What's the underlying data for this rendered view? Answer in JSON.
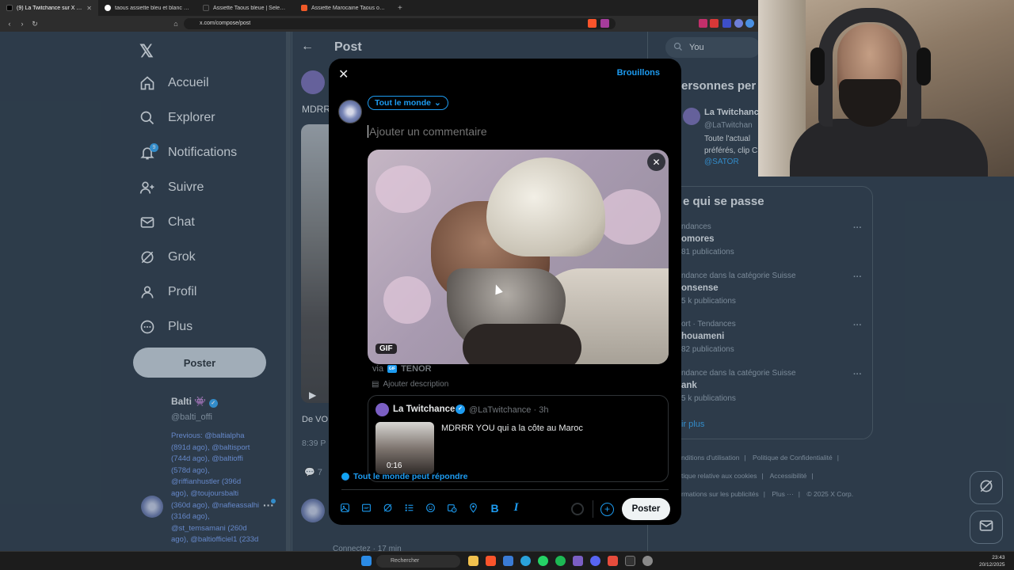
{
  "browser": {
    "tabs": [
      {
        "label": "(9) La Twitchance sur X : \"MDRR",
        "active": true,
        "color": "#000000"
      },
      {
        "label": "taous assiette bleu et blanc - Recher",
        "active": false,
        "color": "#4285f4"
      },
      {
        "label": "Assiette Taous bleue | Selency",
        "active": false,
        "color": "#222222"
      },
      {
        "label": "Assiette Marocaine Taous originale d",
        "active": false,
        "color": "#f05a28"
      }
    ],
    "url": "x.com/compose/post"
  },
  "nav": {
    "items": [
      {
        "label": "Accueil",
        "icon": "home-icon"
      },
      {
        "label": "Explorer",
        "icon": "search-icon"
      },
      {
        "label": "Notifications",
        "icon": "bell-icon",
        "badge": "9"
      },
      {
        "label": "Suivre",
        "icon": "follow-icon"
      },
      {
        "label": "Chat",
        "icon": "mail-icon"
      },
      {
        "label": "Grok",
        "icon": "grok-icon"
      },
      {
        "label": "Profil",
        "icon": "profile-icon"
      },
      {
        "label": "Plus",
        "icon": "more-icon"
      }
    ],
    "post_button": "Poster"
  },
  "profile": {
    "name": "Balti",
    "emoji": "👾",
    "handle": "@balti_offi",
    "bio": "Previous: @baltialpha (891d ago), @baltisport (744d ago), @baltioffi (578d ago), @riffianhustler (396d ago), @toujoursbalti (360d ago), @nafieassalhi (316d ago), @st_temsamani (260d ago), @baltiofficiel1 (233d",
    "more": "···"
  },
  "middle": {
    "title": "Post",
    "text": "MDRR",
    "de": "De VO",
    "time": "8:39 P",
    "reply_count": "7",
    "bottom_text": "Connectez · 17 min"
  },
  "right": {
    "search": "You",
    "suggest_heading": "ersonnes per",
    "suggest_name": "La Twitchanc",
    "suggest_handle": "@LaTwitchan",
    "suggest_bio": "Toute l'actual préférés, clip CM :",
    "suggest_link": "@SATOR",
    "trends_heading": "e qui se passe",
    "trends": [
      {
        "category": "ndances",
        "name": "omores",
        "count": "81 publications"
      },
      {
        "category": "ndance dans la catégorie Suisse",
        "name": "onsense",
        "count": "5 k publications"
      },
      {
        "category": "ort · Tendances",
        "name": "houameni",
        "count": "82 publications"
      },
      {
        "category": "ndance dans la catégorie Suisse",
        "name": "ank",
        "count": "5 k publications"
      }
    ],
    "see_more": "ir plus",
    "footer": [
      "nditions d'utilisation",
      "Politique de Confidentialité",
      "tique relative aux cookies",
      "Accessibilité",
      "rmations sur les publicités",
      "Plus ···",
      "© 2025 X Corp."
    ]
  },
  "modal": {
    "close": "✕",
    "drafts": "Brouillons",
    "audience": "Tout le monde",
    "placeholder": "Ajouter un commentaire",
    "gif_badge": "GIF",
    "via": "via",
    "tenor": "TENOR",
    "add_description": "Ajouter description",
    "quote": {
      "name": "La Twitchance",
      "handle": "@LaTwitchance · 3h",
      "text": "MDRRR YOU qui a la côte au Maroc",
      "duration": "0:16"
    },
    "reply_setting": "Tout le monde peut répondre",
    "post_button": "Poster"
  },
  "taskbar": {
    "search": "Rechercher",
    "time": "23:43",
    "date": "20/12/2025"
  },
  "colors": {
    "accent": "#1d9bf0",
    "background": "#15202b",
    "modal": "#000000"
  }
}
